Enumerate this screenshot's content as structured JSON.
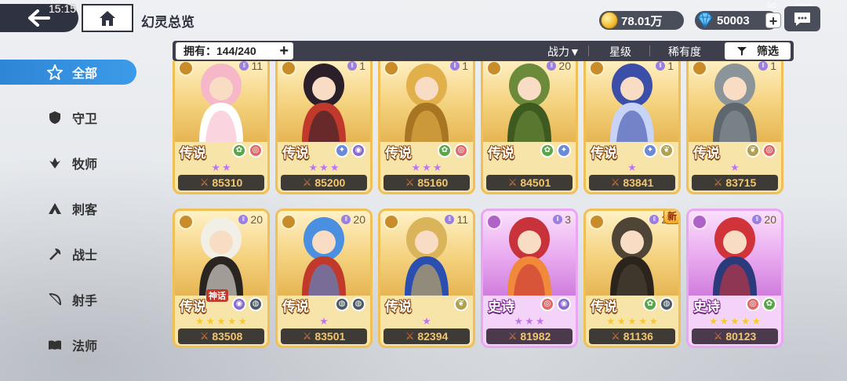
{
  "status": {
    "time": "15:15",
    "network": "5G",
    "battery": "45"
  },
  "header": {
    "title": "幻灵总览"
  },
  "currency": {
    "gold": "78.01万",
    "gems": "50003"
  },
  "filter": {
    "own_label": "拥有：144/240",
    "sort_power": "战力▼",
    "sort_star": "星级",
    "sort_rarity": "稀有度",
    "screen": "筛选"
  },
  "sidebar": {
    "items": [
      {
        "label": "全部",
        "icon": "all-star-icon",
        "active": true
      },
      {
        "label": "守卫",
        "icon": "shield-icon"
      },
      {
        "label": "牧师",
        "icon": "priest-icon"
      },
      {
        "label": "刺客",
        "icon": "assassin-icon"
      },
      {
        "label": "战士",
        "icon": "axe-icon"
      },
      {
        "label": "射手",
        "icon": "bow-icon"
      },
      {
        "label": "法师",
        "icon": "book-icon"
      }
    ]
  },
  "cards": [
    {
      "rarity": "传说",
      "level": "11",
      "stars": 2,
      "power": "85310",
      "elems": [
        "leaf",
        "swirl"
      ],
      "hero": "pink-hair-healer"
    },
    {
      "rarity": "传说",
      "level": "1",
      "stars": 3,
      "power": "85200",
      "elems": [
        "star4",
        "eye"
      ],
      "hero": "pirate-captain"
    },
    {
      "rarity": "传说",
      "level": "1",
      "stars": 3,
      "power": "85160",
      "elems": [
        "leaf",
        "swirl"
      ],
      "hero": "golden-elf"
    },
    {
      "rarity": "传说",
      "level": "20",
      "stars": 0,
      "power": "84501",
      "elems": [
        "leaf",
        "star4"
      ],
      "hero": "tree-guardian"
    },
    {
      "rarity": "传说",
      "level": "1",
      "stars": 1,
      "power": "83841",
      "elems": [
        "star4",
        "wing"
      ],
      "hero": "blue-hair-sorceress"
    },
    {
      "rarity": "传说",
      "level": "1",
      "stars": 1,
      "power": "83715",
      "elems": [
        "wing",
        "swirl"
      ],
      "hero": "stone-golem"
    },
    {
      "rarity": "传说",
      "level": "20",
      "stars": 5,
      "power": "83508",
      "elems": [
        "eye",
        "ring"
      ],
      "hero": "white-hair-queen",
      "mythic": "神话",
      "gold": true
    },
    {
      "rarity": "传说",
      "level": "20",
      "stars": 1,
      "power": "83501",
      "elems": [
        "ring",
        "ring"
      ],
      "hero": "blue-slime-king"
    },
    {
      "rarity": "传说",
      "level": "11",
      "stars": 1,
      "power": "82394",
      "elems": [
        "wing"
      ],
      "hero": "golden-knight"
    },
    {
      "rarity": "史诗",
      "level": "3",
      "stars": 3,
      "power": "81982",
      "elems": [
        "swirl",
        "eye"
      ],
      "hero": "red-dragon-imp",
      "epic": true
    },
    {
      "rarity": "传说",
      "level": "20",
      "stars": 5,
      "power": "81136",
      "elems": [
        "leaf",
        "ring"
      ],
      "hero": "minotaur",
      "gold": true,
      "isNew": "新"
    },
    {
      "rarity": "史诗",
      "level": "20",
      "stars": 5,
      "power": "80123",
      "elems": [
        "swirl",
        "leaf"
      ],
      "hero": "red-hair-lancer",
      "epic": true,
      "gold": true
    }
  ]
}
